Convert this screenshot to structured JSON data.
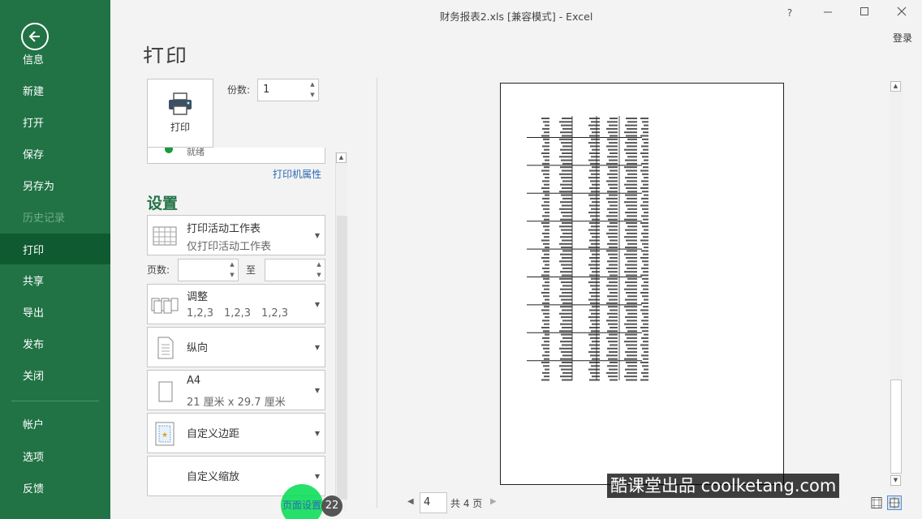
{
  "window": {
    "title": "财务报表2.xls  [兼容模式] - Excel",
    "help": "?",
    "login": "登录"
  },
  "sidebar": {
    "items": [
      {
        "label": "信息",
        "state": "normal"
      },
      {
        "label": "新建",
        "state": "normal"
      },
      {
        "label": "打开",
        "state": "normal"
      },
      {
        "label": "保存",
        "state": "normal"
      },
      {
        "label": "另存为",
        "state": "normal"
      },
      {
        "label": "历史记录",
        "state": "disabled"
      },
      {
        "label": "打印",
        "state": "active"
      },
      {
        "label": "共享",
        "state": "normal"
      },
      {
        "label": "导出",
        "state": "normal"
      },
      {
        "label": "发布",
        "state": "normal"
      },
      {
        "label": "关闭",
        "state": "normal"
      },
      {
        "label": "帐户",
        "state": "normal"
      },
      {
        "label": "选项",
        "state": "normal"
      },
      {
        "label": "反馈",
        "state": "normal"
      }
    ]
  },
  "print": {
    "heading": "打印",
    "print_button": "打印",
    "copies_label": "份数:",
    "copies_value": "1",
    "printer_status": "就绪",
    "printer_properties": "打印机属性"
  },
  "settings": {
    "heading": "设置",
    "what": {
      "main": "打印活动工作表",
      "sub": "仅打印活动工作表"
    },
    "pages_label": "页数:",
    "pages_to": "至",
    "collate": {
      "main": "调整",
      "sub": [
        "1,2,3",
        "1,2,3",
        "1,2,3"
      ]
    },
    "orientation": {
      "main": "纵向"
    },
    "paper": {
      "main": "A4",
      "sub": "21 厘米 x 29.7 厘米"
    },
    "margins": {
      "main": "自定义边距"
    },
    "scaling": {
      "main": "自定义缩放"
    },
    "page_setup_link": "页面设置",
    "step_badge": "22"
  },
  "preview": {
    "current_page": "4",
    "total_pages": "共 4 页"
  },
  "watermark": "酷课堂出品 coolketang.com",
  "colors": {
    "sidebar": "#217346",
    "sidebar_active": "#0f5a30",
    "accent": "#217346",
    "link": "#2b6ab2"
  }
}
